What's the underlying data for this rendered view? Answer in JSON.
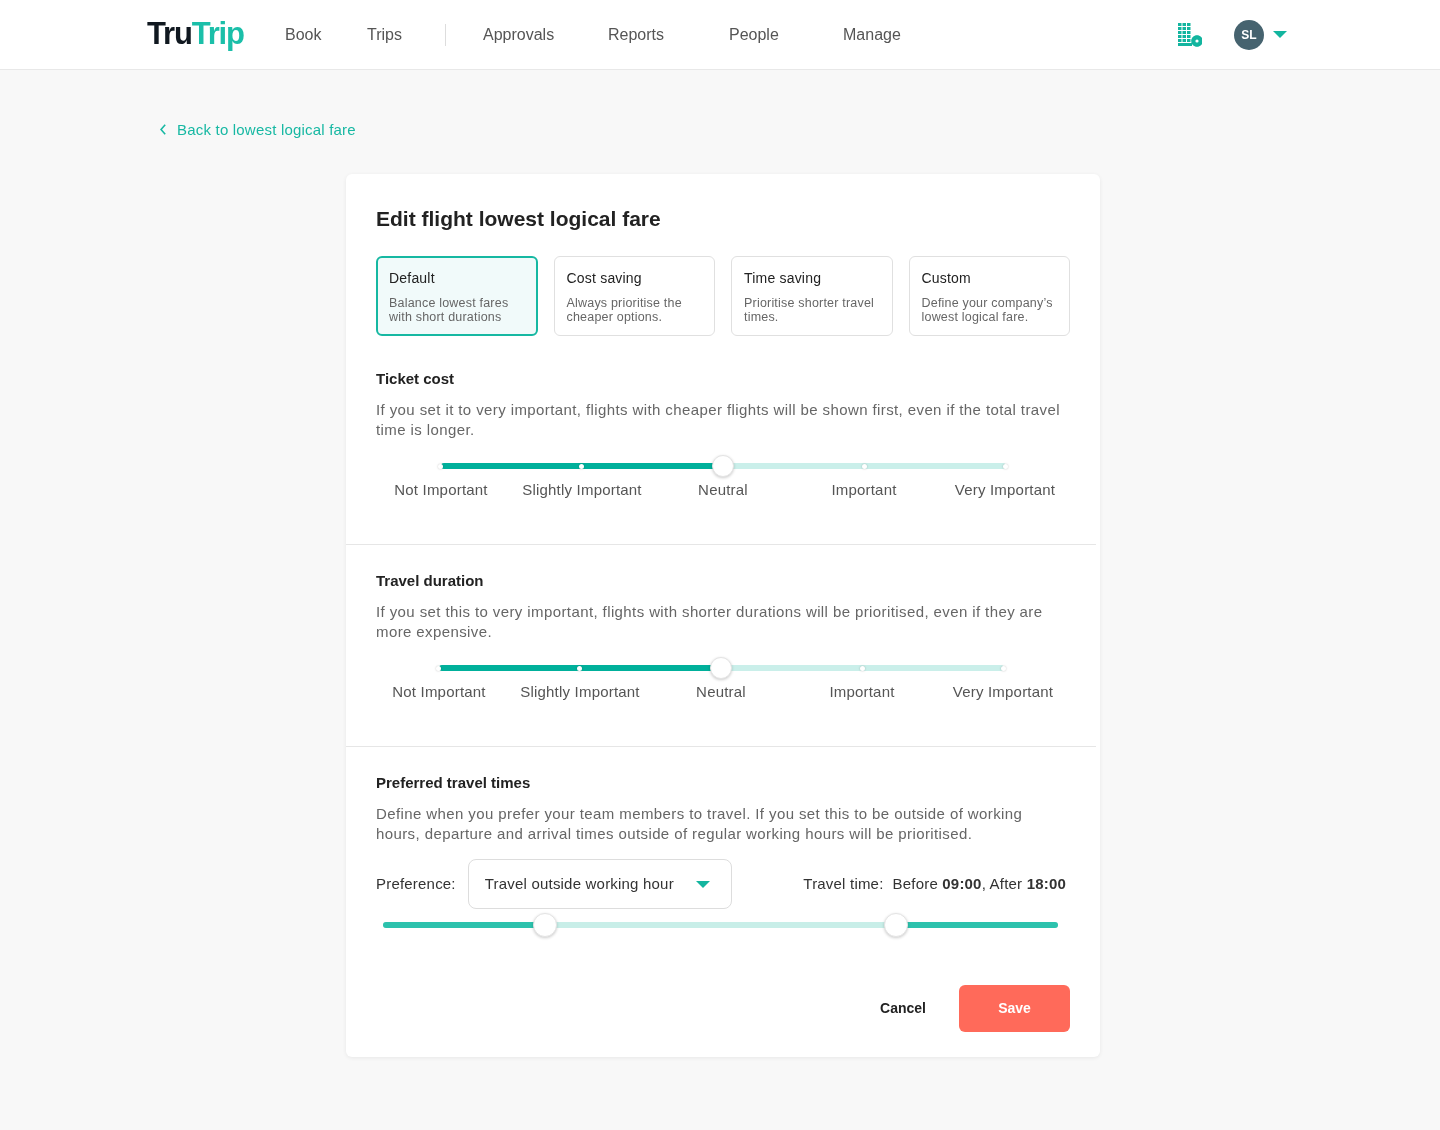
{
  "header": {
    "logo": [
      "Tru",
      "Trip"
    ],
    "nav_groups": [
      {
        "items": [
          {
            "label": "Book",
            "selected": false
          },
          {
            "label": "Trips",
            "selected": false
          }
        ]
      },
      {
        "items": [
          {
            "label": "Approvals",
            "selected": false
          },
          {
            "label": "Reports",
            "selected": false
          },
          {
            "label": "People",
            "selected": false
          },
          {
            "label": "Manage",
            "selected": false
          }
        ]
      }
    ],
    "avatar": {
      "initials": "SL"
    }
  },
  "back_link": {
    "label": "Back to lowest logical fare"
  },
  "card": {
    "title": "Edit flight lowest logical fare",
    "presets": [
      {
        "title": "Default",
        "description": "Balance lowest fares with short durations",
        "selected": true
      },
      {
        "title": "Cost saving",
        "description": "Always prioritise the cheaper options.",
        "selected": false
      },
      {
        "title": "Time saving",
        "description": "Prioritise shorter travel times.",
        "selected": false
      },
      {
        "title": "Custom",
        "description": "Define your company’s lowest logical fare.",
        "selected": false
      }
    ],
    "sections": [
      {
        "kind": "scale",
        "title": "Ticket cost",
        "description": "If you set it to very important, flights with cheaper flights will be shown first, even if the total travel time is longer.",
        "slider": {
          "level": 0.5,
          "labels": [
            "Not Important",
            "Slightly Important",
            "Neutral",
            "Important",
            "Very Important"
          ]
        }
      },
      {
        "kind": "scale",
        "title": "Travel duration",
        "description": "If you set this to very important, flights with shorter durations will be prioritised, even if they are more expensive.",
        "slider": {
          "level": 0.5,
          "labels": [
            "Not Important",
            "Slightly Important",
            "Neutral",
            "Important",
            "Very Important"
          ]
        }
      },
      {
        "kind": "times",
        "title": "Preferred travel times",
        "description": "Define when you prefer your team members to travel. If you set this to be outside of working hours, departure and arrival times outside of regular working hours will be prioritised.",
        "preference": {
          "label": "Preference:",
          "value": "Travel outside working hour"
        },
        "travel_time": {
          "label": "Travel time:",
          "value": "Before **09:00**, After **18:00**"
        },
        "range": {
          "thumbs": [
            {
              "level": 0.24
            },
            {
              "level": 0.76
            }
          ]
        }
      }
    ],
    "actions": {
      "cancel": "Cancel",
      "save": "Save"
    }
  }
}
